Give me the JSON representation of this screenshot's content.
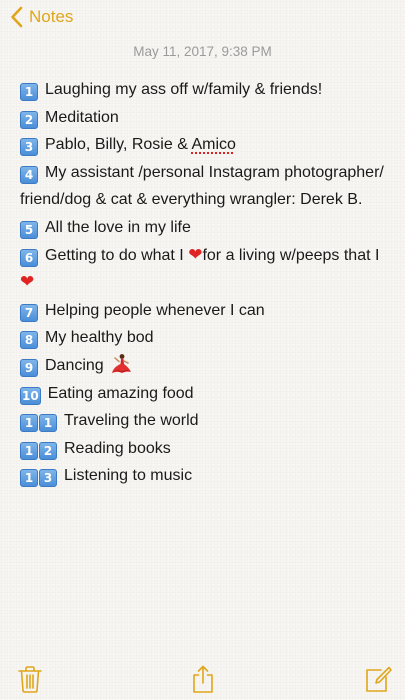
{
  "nav": {
    "back_label": "Notes",
    "accent_color": "#e0a61b"
  },
  "note": {
    "timestamp": "May 11, 2017, 9:38 PM",
    "lines": [
      {
        "keys": [
          "1"
        ],
        "text": "Laughing my ass off w/family & friends!"
      },
      {
        "keys": [
          "2"
        ],
        "text": "Meditation"
      },
      {
        "keys": [
          "3"
        ],
        "text_before": "Pablo, Billy, Rosie & ",
        "misspelled": "Amico"
      },
      {
        "keys": [
          "4"
        ],
        "text": "My assistant /personal Instagram photographer/ friend/dog & cat & everything wrangler: Derek B."
      },
      {
        "keys": [
          "5"
        ],
        "text": "All the love in my life"
      },
      {
        "keys": [
          "6"
        ],
        "text_before": "Getting to do what I ",
        "text_middle": "for a living w/peeps that I "
      },
      {
        "keys": [
          "7"
        ],
        "text": "Helping people whenever I can"
      },
      {
        "keys": [
          "8"
        ],
        "text": "My healthy bod"
      },
      {
        "keys": [
          "9"
        ],
        "text": "Dancing"
      },
      {
        "keys": [
          "10"
        ],
        "text": "Eating amazing food"
      },
      {
        "keys": [
          "1",
          "1"
        ],
        "text": "Traveling the world"
      },
      {
        "keys": [
          "1",
          "2"
        ],
        "text": "Reading books"
      },
      {
        "keys": [
          "1",
          "3"
        ],
        "text": "Listening to music"
      }
    ],
    "emoji": {
      "heart": "❤",
      "dancer": "dancer-emoji"
    }
  },
  "toolbar": {
    "icons": [
      "trash-icon",
      "share-icon",
      "compose-icon"
    ]
  }
}
